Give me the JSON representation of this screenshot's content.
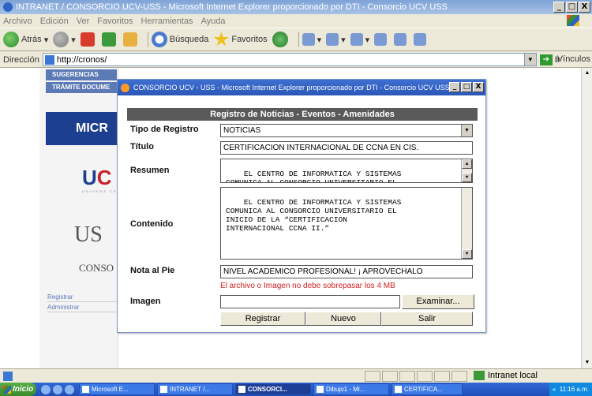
{
  "window": {
    "title": "INTRANET / CONSORCIO UCV-USS - Microsoft Internet Explorer proporcionado por DTI - Consorcio UCV USS",
    "controls": {
      "minimize": "_",
      "maximize": "□",
      "close": "X"
    }
  },
  "menu": [
    "Archivo",
    "Edición",
    "Ver",
    "Favoritos",
    "Herramientas",
    "Ayuda"
  ],
  "toolbar": {
    "back": "Atrás",
    "search": "Búsqueda",
    "favorites": "Favoritos"
  },
  "address": {
    "label": "Dirección",
    "url": "http://cronos/",
    "go": "Ir",
    "links": "Vínculos"
  },
  "sidebar": {
    "nav": [
      "SUGERENCIAS",
      "TRÁMITE DOCUME"
    ],
    "logo_micro": "MICR",
    "logo_uc": {
      "u": "U",
      "c": "C"
    },
    "logo_sub": "UNIVERS CESAR V",
    "logo_us": "US",
    "logo_conso": "CONSO",
    "links": [
      "Registrar",
      "Administrar"
    ]
  },
  "popup": {
    "title": "CONSORCIO UCV - USS - Microsoft Internet Explorer proporcionado por DTI - Consorcio UCV USS",
    "header": "Registro de Noticias - Eventos - Amenidades",
    "fields": {
      "tipo_label": "Tipo de Registro",
      "tipo_value": "NOTICIAS",
      "titulo_label": "Título",
      "titulo_value": "CERTIFICACION INTERNACIONAL DE CCNA EN CIS.",
      "resumen_label": "Resumen",
      "resumen_value": "EL CENTRO DE INFORMATICA Y SISTEMAS\nCOMUNICA AL CONSORCIO UNIVERSITARIO EL",
      "contenido_label": "Contenido",
      "contenido_value": "EL CENTRO DE INFORMATICA Y SISTEMAS\nCOMUNICA AL CONSORCIO UNIVERSITARIO EL\nINICIO DE LA “CERTIFICACION\nINTERNACIONAL CCNA II.”",
      "nota_label": "Nota al Pie",
      "nota_value": "NIVEL ACADEMICO PROFESIONAL! ¡ APROVECHALO",
      "imagen_label": "Imagen",
      "imagen_warning": "El archivo o Imagen no debe sobrepasar los 4 MB",
      "browse": "Examinar..."
    },
    "buttons": {
      "registrar": "Registrar",
      "nuevo": "Nuevo",
      "salir": "Salir"
    }
  },
  "status": {
    "zone": "Intranet local"
  },
  "taskbar": {
    "start": "Inicio",
    "tasks": [
      "Microsoft E...",
      "INTRANET /...",
      "CONSORCI...",
      "Dibujo1 - Mi...",
      "CERTIFICA..."
    ],
    "clock": "11:16 a.m."
  }
}
